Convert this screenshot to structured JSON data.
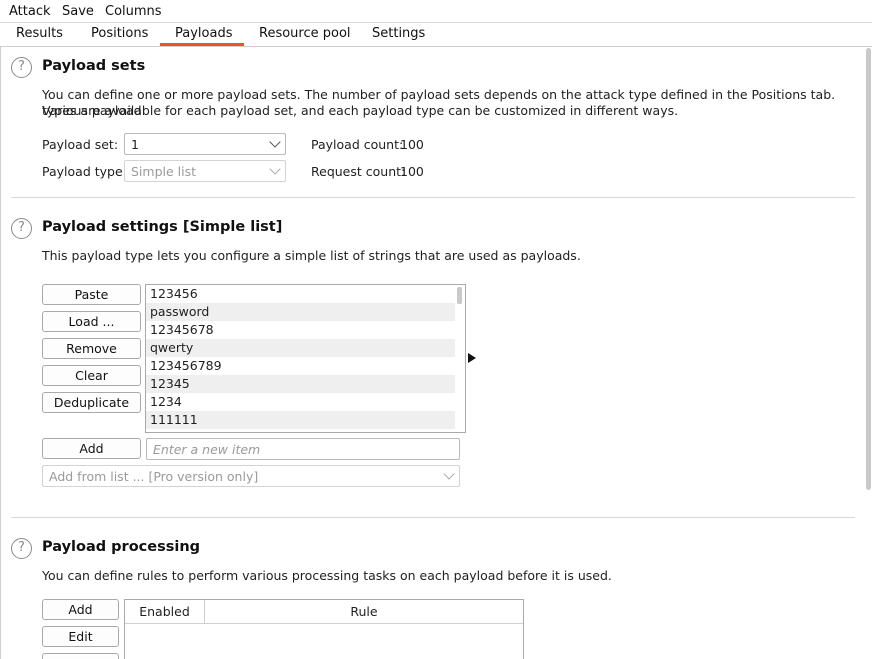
{
  "menu": [
    "Attack",
    "Save",
    "Columns"
  ],
  "tabs": [
    {
      "label": "Results"
    },
    {
      "label": "Positions"
    },
    {
      "label": "Payloads",
      "active": true
    },
    {
      "label": "Resource pool"
    },
    {
      "label": "Settings"
    }
  ],
  "accent_color": "#e8542a",
  "help_glyph": "?",
  "payload_sets": {
    "title": "Payload sets",
    "description_line1": "You can define one or more payload sets. The number of payload sets depends on the attack type defined in the Positions tab. Various payload",
    "description_line2": "types are available for each payload set, and each payload type can be customized in different ways.",
    "set_label": "Payload set:",
    "set_value": "1",
    "type_label": "Payload type:",
    "type_value": "Simple list",
    "count_label": "Payload count:",
    "count_value": "100",
    "request_label": "Request count:",
    "request_value": "100"
  },
  "payload_settings": {
    "title": "Payload settings [Simple list]",
    "description": "This payload type lets you configure a simple list of strings that are used as payloads.",
    "buttons": {
      "paste": "Paste",
      "load": "Load ...",
      "remove": "Remove",
      "clear": "Clear",
      "deduplicate": "Deduplicate",
      "add": "Add"
    },
    "items": [
      "123456",
      "password",
      "12345678",
      "qwerty",
      "123456789",
      "12345",
      "1234",
      "111111"
    ],
    "new_item_placeholder": "Enter a new item",
    "add_from_list": "Add from list ... [Pro version only]"
  },
  "payload_processing": {
    "title": "Payload processing",
    "description": "You can define rules to perform various processing tasks on each payload before it is used.",
    "buttons": {
      "add": "Add",
      "edit": "Edit"
    },
    "columns": [
      "Enabled",
      "Rule"
    ]
  }
}
